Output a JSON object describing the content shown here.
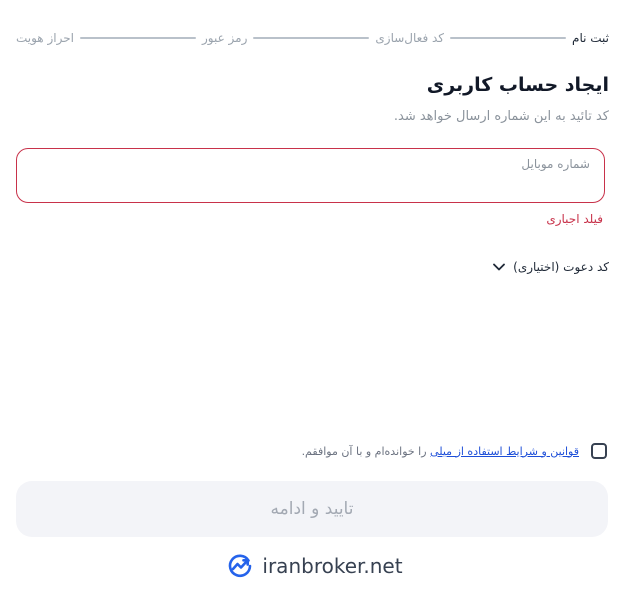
{
  "stepper": {
    "steps": [
      {
        "label": "ثبت نام",
        "active": true
      },
      {
        "label": "کد فعال‌سازی",
        "active": false
      },
      {
        "label": "رمز عبور",
        "active": false
      },
      {
        "label": "احراز هویت",
        "active": false
      }
    ]
  },
  "form": {
    "title": "ایجاد حساب کاربری",
    "subtitle": "کد تائید به این شماره ارسال خواهد شد.",
    "mobile_field": {
      "label": "شماره موبایل",
      "value": ""
    },
    "error": "فیلد اجباری",
    "invite_code_toggle": "کد دعوت (اختیاری)"
  },
  "terms": {
    "link_text": "قوانین و شرایط استفاده از میلی",
    "suffix_text": " را خوانده‌ام و با آن موافقم."
  },
  "submit": {
    "label": "تایید و ادامه"
  },
  "brand": {
    "text": "iranbroker.net"
  },
  "colors": {
    "error": "#c8324a",
    "link": "#1d4ed8",
    "logo": "#2563eb",
    "submit_bg": "#f3f4f8"
  }
}
